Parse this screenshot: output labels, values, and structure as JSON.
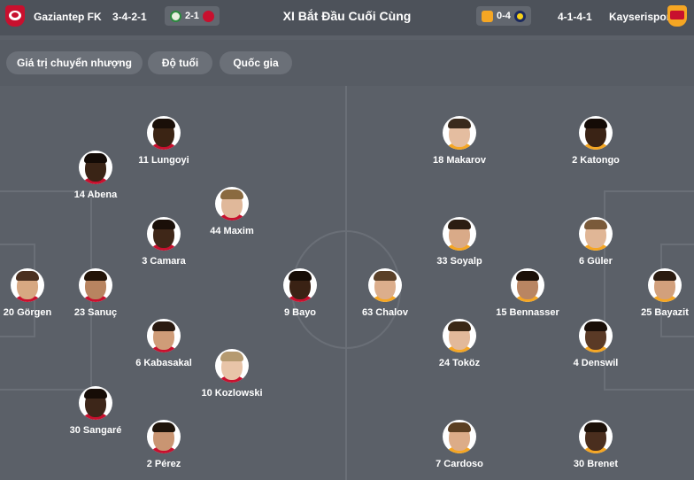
{
  "header": {
    "home_team": "Gaziantep FK",
    "home_formation": "3-4-2-1",
    "home_score": "2-1",
    "title": "XI Bắt Đầu Cuối Cùng",
    "away_score": "0-4",
    "away_formation": "4-1-4-1",
    "away_team": "Kayserispor",
    "colors": {
      "home": "#c8102e",
      "away": "#f5a623",
      "away_secondary": "#c8102e",
      "fener": "#f7d117"
    }
  },
  "filters": [
    "Giá trị chuyển nhượng",
    "Độ tuổi",
    "Quốc gia"
  ],
  "home_players": [
    {
      "label": "11 Lungoyi",
      "skin": "#3b2414",
      "hair": "#1a0f08"
    },
    {
      "label": "14 Abena",
      "skin": "#3a2416",
      "hair": "#140b06"
    },
    {
      "label": "44 Maxim",
      "skin": "#e0b89a",
      "hair": "#8a6a40"
    },
    {
      "label": "3 Camara",
      "skin": "#3f2718",
      "hair": "#1a0f08"
    },
    {
      "label": "20 Görgen",
      "skin": "#d7a882",
      "hair": "#4a3020"
    },
    {
      "label": "23 Sanuç",
      "skin": "#b88460",
      "hair": "#231408"
    },
    {
      "label": "9 Bayo",
      "skin": "#3a2214",
      "hair": "#170d06"
    },
    {
      "label": "6 Kabasakal",
      "skin": "#cf9c78",
      "hair": "#2a1a10"
    },
    {
      "label": "10 Kozlowski",
      "skin": "#e8c4a8",
      "hair": "#b59a70"
    },
    {
      "label": "30 Sangaré",
      "skin": "#3d2619",
      "hair": "#160c06"
    },
    {
      "label": "2 Pérez",
      "skin": "#c99572",
      "hair": "#1f140a"
    }
  ],
  "away_players": [
    {
      "label": "18 Makarov",
      "skin": "#e4bda0",
      "hair": "#3a2a1c"
    },
    {
      "label": "2 Katongo",
      "skin": "#3a2315",
      "hair": "#140b06"
    },
    {
      "label": "33 Soyalp",
      "skin": "#d9aa88",
      "hair": "#2b1d12"
    },
    {
      "label": "6 Güler",
      "skin": "#e0b696",
      "hair": "#7a5a3a"
    },
    {
      "label": "63 Chalov",
      "skin": "#dcae8c",
      "hair": "#5a4028"
    },
    {
      "label": "15 Bennasser",
      "skin": "#b98562",
      "hair": "#1c1008"
    },
    {
      "label": "25 Bayazit",
      "skin": "#d2a07c",
      "hair": "#2b1b10"
    },
    {
      "label": "24 Toköz",
      "skin": "#e2b99a",
      "hair": "#3a2816"
    },
    {
      "label": "4 Denswil",
      "skin": "#5a3a26",
      "hair": "#1a0f08"
    },
    {
      "label": "7 Cardoso",
      "skin": "#dcac88",
      "hair": "#5b3f22"
    },
    {
      "label": "30 Brenet",
      "skin": "#4a2e1e",
      "hair": "#1c1008"
    }
  ]
}
